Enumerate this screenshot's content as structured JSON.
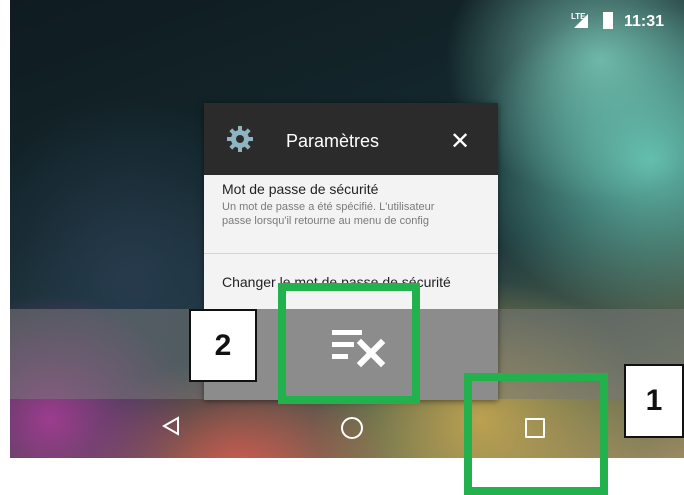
{
  "status_bar": {
    "network": "LTE",
    "time": "11:31"
  },
  "recent_card": {
    "title": "Paramètres",
    "icon": "gear-icon",
    "preference_title": "Mot de passe de sécurité",
    "preference_summary_line1": "Un mot de passe a été spécifié. L'utilisateur",
    "preference_summary_line2": "passe lorsqu'il retourne au menu de config",
    "second_item": "Changer le mot de passe de sécurité"
  },
  "clear_all": {
    "icon": "clear-all-icon"
  },
  "nav_bar": {
    "back_icon": "back-icon",
    "home_icon": "home-icon",
    "recents_icon": "recents-icon"
  },
  "annotations": {
    "label_1": "1",
    "label_2": "2",
    "highlight_color": "#22b14c"
  }
}
